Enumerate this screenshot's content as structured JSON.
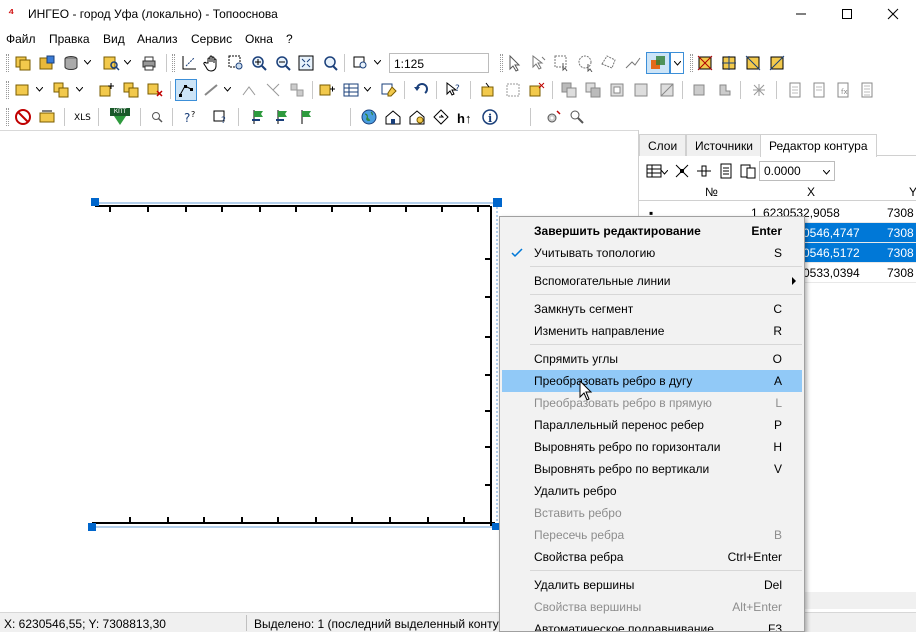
{
  "window": {
    "title": "ИНГЕО - город Уфа (локально) - Топооснова"
  },
  "menu": [
    "Файл",
    "Правка",
    "Вид",
    "Анализ",
    "Сервис",
    "Окна",
    "?"
  ],
  "toolbar": {
    "scale_value": "1:125",
    "xls_label": "XLS",
    "kpt_label": "КПТ"
  },
  "panel": {
    "tabs": [
      "Слои",
      "Источники",
      "Редактор контура"
    ],
    "active_tab": "Редактор контура",
    "offset_value": "0.0000",
    "columns": [
      "№",
      "X",
      "Y"
    ],
    "rows": [
      {
        "num": "1",
        "x": "6230532,9058",
        "y": "7308",
        "selected": false
      },
      {
        "num": "",
        "x": "0546,4747",
        "y": "7308",
        "selected": true
      },
      {
        "num": "",
        "x": "0546,5172",
        "y": "7308",
        "selected": true
      },
      {
        "num": "",
        "x": "0533,0394",
        "y": "7308",
        "selected": false
      }
    ]
  },
  "context_menu": {
    "items": [
      {
        "label": "Завершить редактирование",
        "shortcut": "Enter",
        "bold": true
      },
      {
        "label": "Учитывать топологию",
        "shortcut": "S",
        "checked": true
      },
      {
        "label": "Вспомогательные линии",
        "submenu": true
      },
      {
        "label": "Замкнуть сегмент",
        "shortcut": "C"
      },
      {
        "label": "Изменить направление",
        "shortcut": "R"
      },
      {
        "label": "Спрямить углы",
        "shortcut": "O"
      },
      {
        "label": "Преобразовать ребро в дугу",
        "shortcut": "A",
        "highlighted": true
      },
      {
        "label": "Преобразовать ребро в прямую",
        "shortcut": "L",
        "disabled": true
      },
      {
        "label": "Параллельный перенос ребер",
        "shortcut": "P"
      },
      {
        "label": "Выровнять ребро по горизонтали",
        "shortcut": "H"
      },
      {
        "label": "Выровнять ребро по вертикали",
        "shortcut": "V"
      },
      {
        "label": "Удалить ребро",
        "shortcut": ""
      },
      {
        "label": "Вставить ребро",
        "shortcut": "",
        "disabled": true
      },
      {
        "label": "Пересечь ребра",
        "shortcut": "B",
        "disabled": true
      },
      {
        "label": "Свойства ребра",
        "shortcut": "Ctrl+Enter"
      },
      {
        "label": "Удалить вершины",
        "shortcut": "Del"
      },
      {
        "label": "Свойства вершины",
        "shortcut": "Alt+Enter",
        "disabled": true
      },
      {
        "label": "Автоматическое подравнивание",
        "shortcut": "F3"
      }
    ]
  },
  "status": {
    "coords": "X: 6230546,55; Y: 7308813,30",
    "selection": "Выделено: 1 (последний выделенный контур"
  },
  "colors": {
    "selection": "#0078d7",
    "menu_highlight": "#91c9f7",
    "handle": "#0066cc"
  }
}
